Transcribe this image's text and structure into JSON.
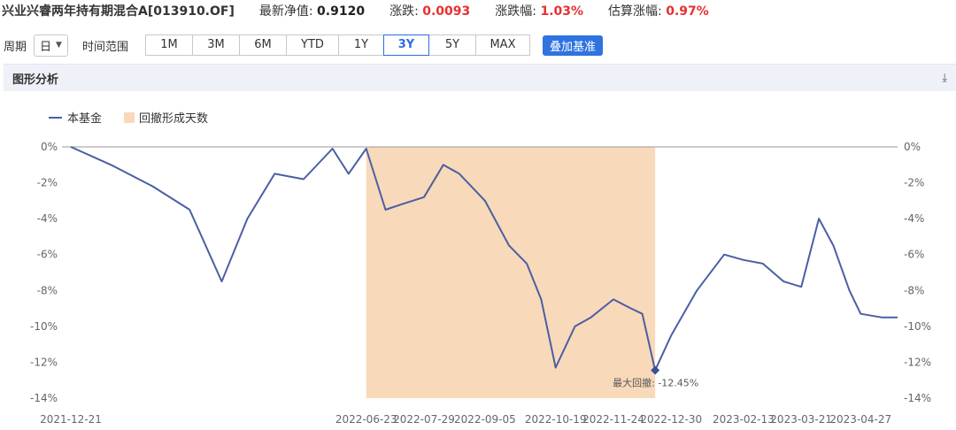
{
  "header": {
    "fund_name": "兴业兴睿两年持有期混合A[013910.OF]",
    "nav_label": "最新净值:",
    "nav_value": "0.9120",
    "change_label": "涨跌:",
    "change_value": "0.0093",
    "pct_label": "涨跌幅:",
    "pct_value": "1.03%",
    "est_label": "估算涨幅:",
    "est_value": "0.97%"
  },
  "toolbar": {
    "period_label": "周期",
    "period_value": "日",
    "range_label": "时间范围",
    "ranges": [
      "1M",
      "3M",
      "6M",
      "YTD",
      "1Y",
      "3Y",
      "5Y",
      "MAX"
    ],
    "active_range": "3Y",
    "benchmark_button": "叠加基准"
  },
  "panel": {
    "title": "图形分析"
  },
  "colors": {
    "line": "#4a5fa3",
    "drawdown_fill": "#f8d9b9",
    "accent_blue": "#2e6be6",
    "up_red": "#e83030"
  },
  "chart_data": {
    "type": "line",
    "legend": [
      "本基金",
      "回撤形成天数"
    ],
    "y_ticks": [
      "0%",
      "-2%",
      "-4%",
      "-6%",
      "-8%",
      "-10%",
      "-12%",
      "-14%"
    ],
    "ylim": [
      -14,
      0
    ],
    "x_ticks": [
      "2021-12-21",
      "2022-06-23",
      "2022-07-29",
      "2022-09-05",
      "2022-10-19",
      "2022-11-24",
      "2022-12-30",
      "2023-02-13",
      "2023-03-21",
      "2023-04-27"
    ],
    "drawdown_region": {
      "start": "2022-06-23",
      "end": "2022-12-20"
    },
    "max_drawdown": {
      "label": "最大回撤: -12.45%",
      "value": -12.45,
      "date": "2022-12-20"
    },
    "series": [
      {
        "name": "本基金",
        "x": [
          "2021-12-21",
          "2022-01-15",
          "2022-02-10",
          "2022-03-05",
          "2022-03-25",
          "2022-04-10",
          "2022-04-27",
          "2022-05-15",
          "2022-06-02",
          "2022-06-12",
          "2022-06-23",
          "2022-07-05",
          "2022-07-15",
          "2022-07-29",
          "2022-08-10",
          "2022-08-20",
          "2022-09-05",
          "2022-09-20",
          "2022-10-01",
          "2022-10-10",
          "2022-10-19",
          "2022-10-31",
          "2022-11-10",
          "2022-11-24",
          "2022-12-05",
          "2022-12-12",
          "2022-12-20",
          "2022-12-30",
          "2023-01-15",
          "2023-02-01",
          "2023-02-13",
          "2023-02-25",
          "2023-03-10",
          "2023-03-21",
          "2023-04-01",
          "2023-04-10",
          "2023-04-20",
          "2023-04-27",
          "2023-05-10",
          "2023-05-20"
        ],
        "y": [
          0,
          -1.0,
          -2.2,
          -3.5,
          -7.5,
          -4.0,
          -1.5,
          -1.8,
          -0.1,
          -1.5,
          -0.1,
          -3.5,
          -3.2,
          -2.8,
          -1.0,
          -1.5,
          -3.0,
          -5.5,
          -6.5,
          -8.5,
          -12.3,
          -10.0,
          -9.5,
          -8.5,
          -9.0,
          -9.3,
          -12.45,
          -10.5,
          -8.0,
          -6.0,
          -6.3,
          -6.5,
          -7.5,
          -7.8,
          -4.0,
          -5.5,
          -8.0,
          -9.3,
          -9.5,
          -9.5
        ]
      }
    ]
  }
}
